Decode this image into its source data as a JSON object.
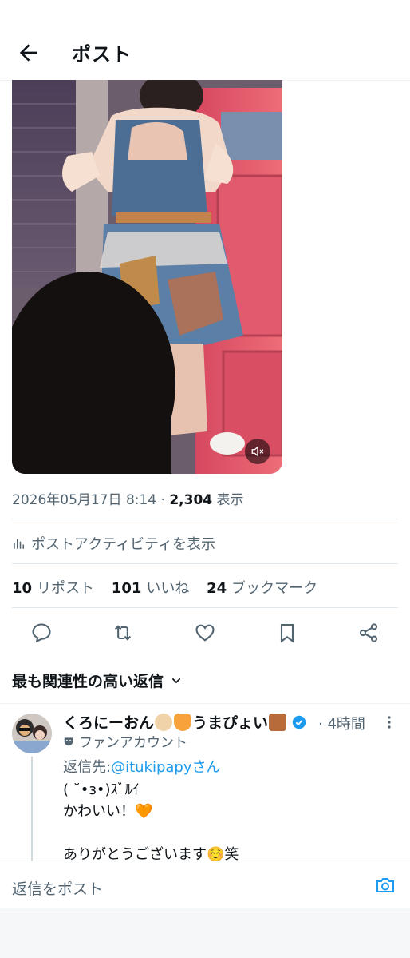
{
  "header": {
    "title": "ポスト",
    "back_icon": "arrow-left-icon"
  },
  "media": {
    "alt": "",
    "mute_icon": "speaker-muted-icon"
  },
  "meta": {
    "date": "2026年05月17日",
    "time": "8:14",
    "views": "2,304",
    "views_label": "表示"
  },
  "activity": {
    "label": "ポストアクティビティを表示",
    "icon": "bar-chart-icon"
  },
  "stats": {
    "reposts": "10",
    "reposts_label": "リポスト",
    "likes": "101",
    "likes_label": "いいね",
    "bookmarks": "24",
    "bookmarks_label": "ブックマーク"
  },
  "actions": [
    "reply-icon",
    "repost-icon",
    "like-icon",
    "bookmark-icon",
    "share-icon"
  ],
  "sort": {
    "label": "最も関連性の高い返信"
  },
  "reply": {
    "name": "くろにーおん",
    "name2": "うまぴょい",
    "time": "4時間",
    "label": "ファンアカウント",
    "reply_prefix": "返信先:",
    "reply_handle": "@itukipapyさん",
    "text": "( ˘•з•)ｽﾞﾙｲ\nかわいい！🧡\n\nありがとうございます☺️笑"
  },
  "composer": {
    "placeholder": "返信をポスト"
  },
  "colors": {
    "accent": "#1d9bf0",
    "secondary": "#536471",
    "text": "#0f1419"
  }
}
